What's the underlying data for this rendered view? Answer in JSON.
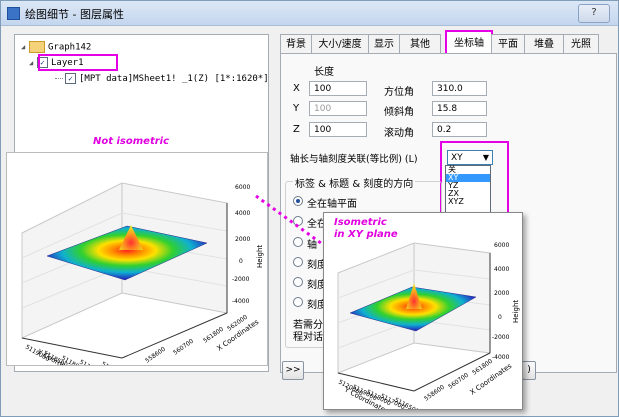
{
  "window": {
    "title": "绘图细节 - 图层属性",
    "help_label": "?"
  },
  "tree": {
    "root": "Graph142",
    "layer": "Layer1",
    "plot": "[MPT data]MSheet1! _1(Z) [1*:1620*]"
  },
  "tabs": [
    {
      "label": "背景"
    },
    {
      "label": "大小/速度"
    },
    {
      "label": "显示"
    },
    {
      "label": "其他"
    },
    {
      "label": "坐标轴",
      "selected": true
    },
    {
      "label": "平面"
    },
    {
      "label": "堆叠"
    },
    {
      "label": "光照"
    }
  ],
  "axis_panel": {
    "length_label": "长度",
    "rows": [
      {
        "axis": "X",
        "length": "100",
        "angle_label": "方位角",
        "angle": "310.0",
        "length_disabled": false
      },
      {
        "axis": "Y",
        "length": "100",
        "angle_label": "倾斜角",
        "angle": "15.8",
        "length_disabled": true
      },
      {
        "axis": "Z",
        "length": "100",
        "angle_label": "滚动角",
        "angle": "0.2",
        "length_disabled": false
      }
    ],
    "isometric_label": "轴长与轴刻度关联(等比例) (L)",
    "combo_value": "XY",
    "combo_options": [
      {
        "label": "关",
        "selected": false
      },
      {
        "label": "XY",
        "selected": true
      },
      {
        "label": "YZ",
        "selected": false
      },
      {
        "label": "ZX",
        "selected": false
      },
      {
        "label": "XYZ",
        "selected": false
      }
    ],
    "direction_group": "标签 & 标题 & 刻度的方向",
    "radio_options": [
      {
        "label": "全在轴平面",
        "checked": true
      },
      {
        "label": "全在",
        "checked": false
      },
      {
        "label": "轴",
        "checked": false
      },
      {
        "label": "刻度",
        "checked": false
      },
      {
        "label": "刻度",
        "checked": false
      },
      {
        "label": "刻度",
        "checked": false
      }
    ],
    "note_line1": "若需分",
    "note_line2": "程对话"
  },
  "bottom": {
    "expand_label": ">>",
    "apply_partial": ")"
  },
  "annotations": {
    "not_isometric": "Not isometric",
    "isometric_line1": "Isometric",
    "isometric_line2": "in XY plane"
  },
  "plot_large": {
    "z_ticks": [
      "6000",
      "4000",
      "2000",
      "0",
      "-2000",
      "-4000"
    ],
    "z_label": "Height",
    "y_ticks": [
      "5119000",
      "5118500",
      "5118000",
      "5117500",
      "5116500"
    ],
    "y_label": "Y Coordinates",
    "x_ticks": [
      "562000",
      "561800",
      "560700",
      "558600"
    ],
    "x_label": "X Coordinates"
  },
  "plot_inset": {
    "z_ticks": [
      "6000",
      "4000",
      "2000",
      "0",
      "-2000",
      "-4000"
    ],
    "z_label": "Height",
    "y_ticks": [
      "5120000",
      "5119000",
      "5118000",
      "5117000",
      "5116500"
    ],
    "y_label": "Y Coordinates",
    "x_ticks": [
      "561800",
      "560700",
      "558600"
    ],
    "x_label": "X Coordinates"
  },
  "colors": {
    "highlight": "#e600e6",
    "selection": "#3399ff"
  }
}
